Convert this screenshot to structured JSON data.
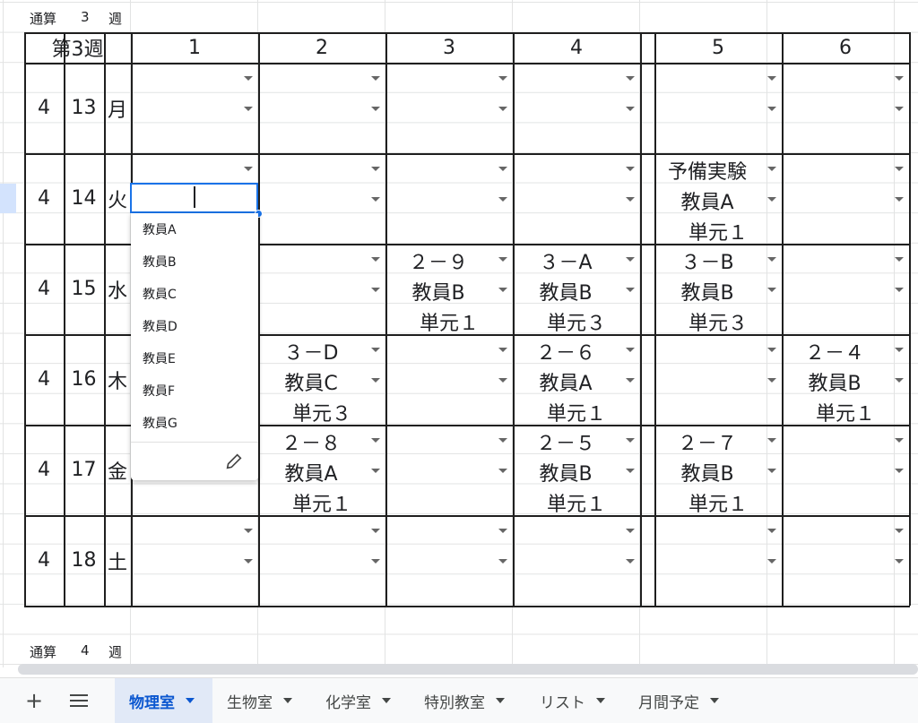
{
  "header_left": {
    "label": "通算",
    "num": "3",
    "unit": "週"
  },
  "footer_left": {
    "label": "通算",
    "num": "4",
    "unit": "週"
  },
  "table": {
    "week_title": "第3週",
    "periods": [
      "1",
      "2",
      "3",
      "4",
      "5",
      "6"
    ],
    "days": [
      {
        "month": "4",
        "date": "13",
        "dow": "月"
      },
      {
        "month": "4",
        "date": "14",
        "dow": "火"
      },
      {
        "month": "4",
        "date": "15",
        "dow": "水"
      },
      {
        "month": "4",
        "date": "16",
        "dow": "木"
      },
      {
        "month": "4",
        "date": "17",
        "dow": "金"
      },
      {
        "month": "4",
        "date": "18",
        "dow": "土"
      }
    ],
    "entries": {
      "d1_p5": [
        "予備実験",
        "教員A",
        "単元１"
      ],
      "d2_p3": [
        "２－９",
        "教員B",
        "単元１"
      ],
      "d2_p4": [
        "３－A",
        "教員B",
        "単元３"
      ],
      "d2_p5": [
        "３－B",
        "教員B",
        "単元３"
      ],
      "d3_p2": [
        "３－D",
        "教員C",
        "単元３"
      ],
      "d3_p4": [
        "２－６",
        "教員A",
        "単元１"
      ],
      "d3_p6": [
        "２－４",
        "教員B",
        "単元１"
      ],
      "d4_p2": [
        "２－８",
        "教員A",
        "単元１"
      ],
      "d4_p4": [
        "２－５",
        "教員B",
        "単元１"
      ],
      "d4_p5": [
        "２－７",
        "教員B",
        "単元１"
      ]
    }
  },
  "dropdown": {
    "options": [
      "教員A",
      "教員B",
      "教員C",
      "教員D",
      "教員E",
      "教員F",
      "教員G"
    ],
    "edit_icon": "pencil-icon"
  },
  "tabs": {
    "add_icon": "plus-icon",
    "menu_icon": "hamburger-icon",
    "sheets": [
      {
        "label": "物理室",
        "active": true
      },
      {
        "label": "生物室",
        "active": false
      },
      {
        "label": "化学室",
        "active": false
      },
      {
        "label": "特別教室",
        "active": false
      },
      {
        "label": "リスト",
        "active": false
      },
      {
        "label": "月間予定",
        "active": false
      }
    ]
  },
  "colors": {
    "accent": "#1a73e8",
    "active_tab_bg": "#e1e9f7",
    "active_tab_text": "#0b57d0"
  }
}
